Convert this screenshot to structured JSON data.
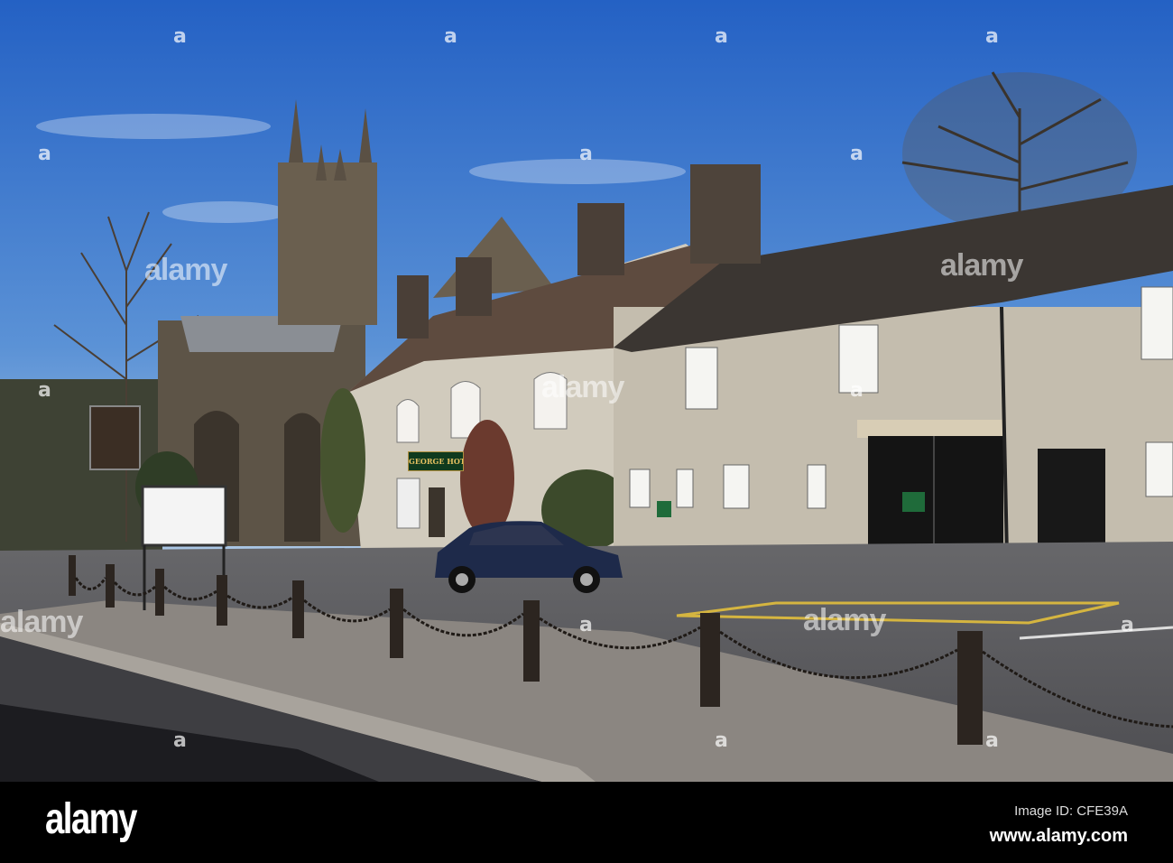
{
  "photo": {
    "hotel_sign": "GEORGE HOTEL",
    "colors": {
      "sky_top": "#2a66c8",
      "sky_bottom": "#a9c6e4",
      "stone": "#c9c2b4",
      "roof": "#3b3632",
      "tarmac": "#5b5b5e",
      "car": "#1e2a4a"
    }
  },
  "watermark": {
    "text": "alamy",
    "dot": "a"
  },
  "footer": {
    "logo": "alamy",
    "image_id": "Image ID: CFE39A",
    "website": "www.alamy.com"
  }
}
